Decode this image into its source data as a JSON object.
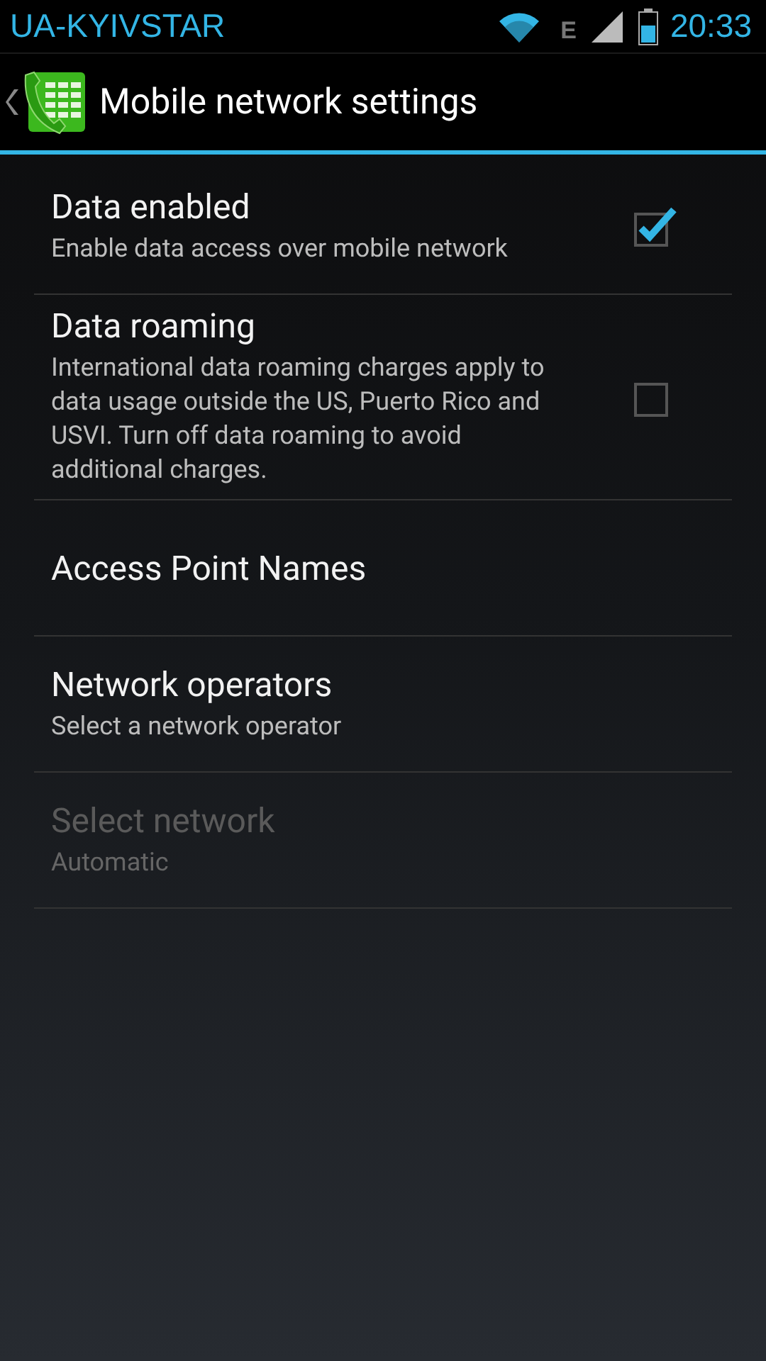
{
  "status_bar": {
    "carrier": "UA-KYIVSTAR",
    "network_type": "E",
    "time": "20:33"
  },
  "action_bar": {
    "title": "Mobile network settings"
  },
  "preferences": [
    {
      "kind": "checkbox",
      "title": "Data enabled",
      "summary": "Enable data access over mobile network",
      "checked": true,
      "disabled": false
    },
    {
      "kind": "checkbox",
      "title": "Data roaming",
      "summary": "International data roaming charges apply to data usage outside the US, Puerto Rico and USVI. Turn off data roaming to avoid additional charges.",
      "checked": false,
      "disabled": false
    },
    {
      "kind": "plain",
      "title": "Access Point Names",
      "disabled": false
    },
    {
      "kind": "plain",
      "title": "Network operators",
      "summary": "Select a network operator",
      "disabled": false
    },
    {
      "kind": "plain",
      "title": "Select network",
      "summary": "Automatic",
      "disabled": true
    }
  ]
}
